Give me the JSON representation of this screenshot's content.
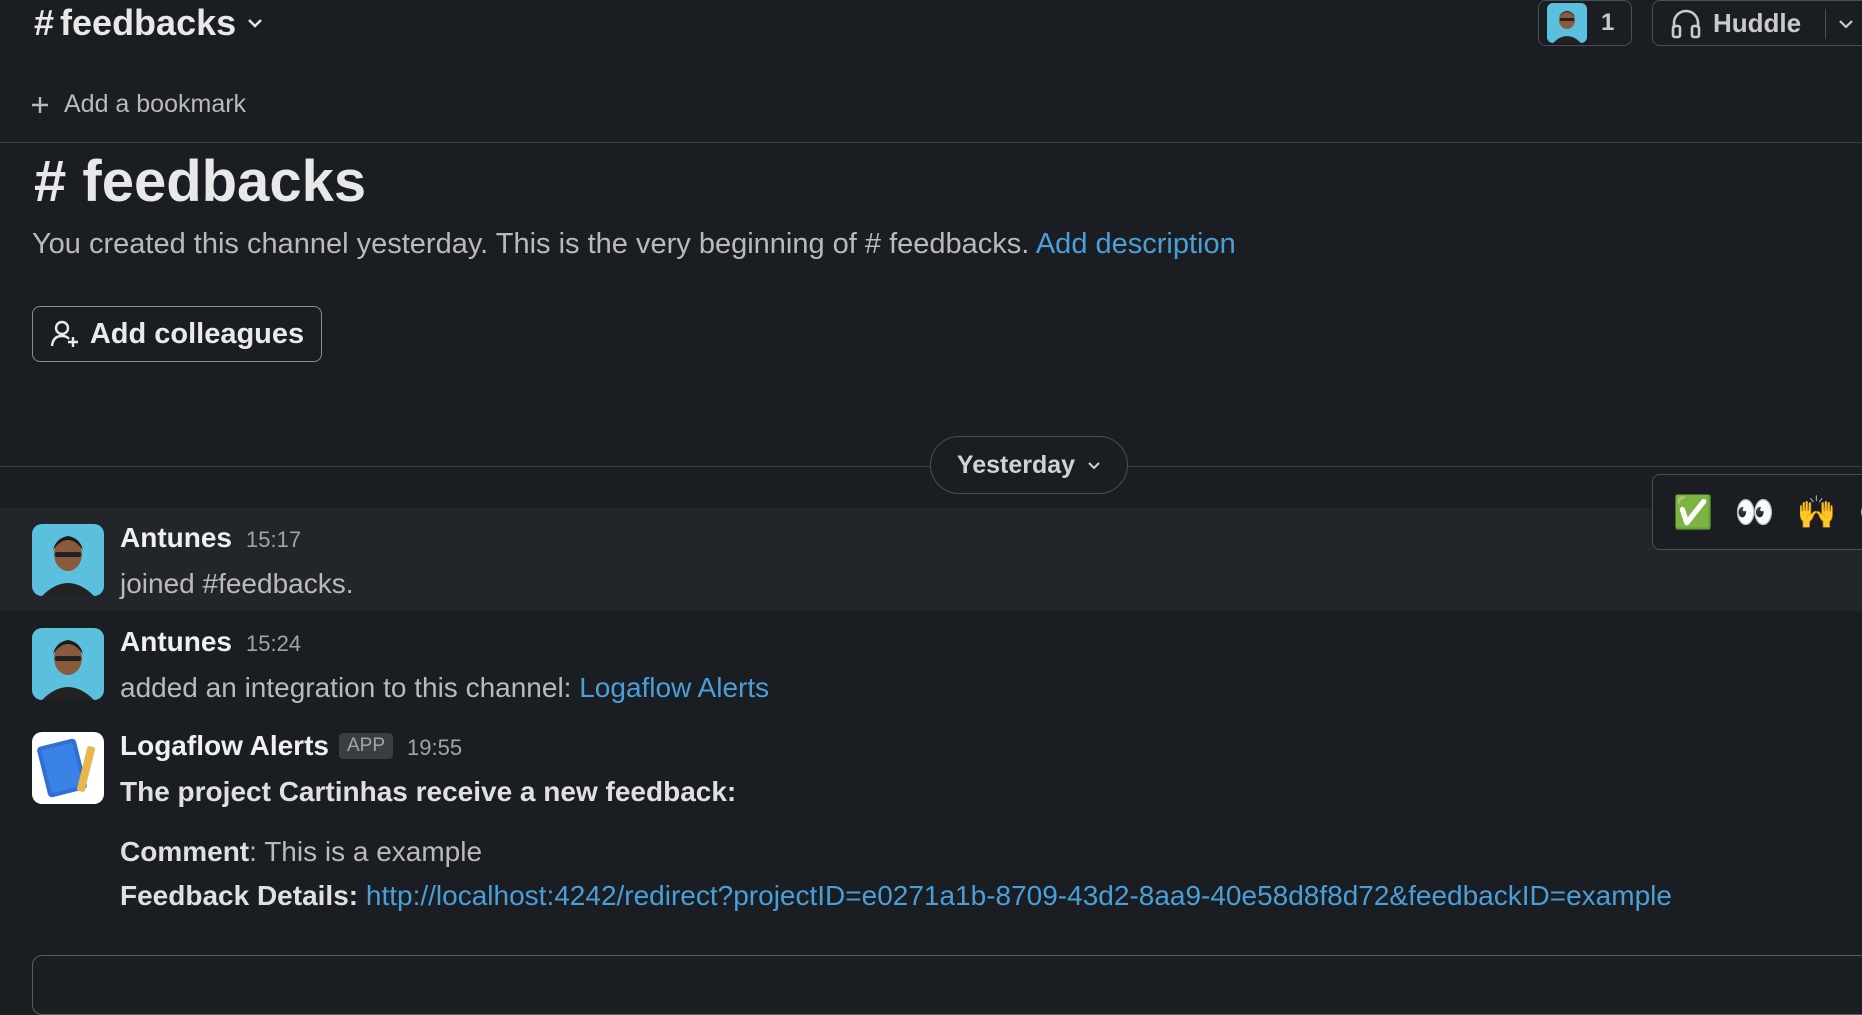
{
  "header": {
    "channel_name": "feedbacks",
    "member_count": "1",
    "huddle_label": "Huddle",
    "bookmark_label": "Add a bookmark"
  },
  "intro": {
    "title": "feedbacks",
    "text_prefix": "You created this channel yesterday. This is the very beginning of ",
    "channel_ref": "# feedbacks.",
    "add_description": "Add description",
    "add_colleagues": "Add colleagues"
  },
  "divider": {
    "label": "Yesterday"
  },
  "reactions": [
    "✅",
    "👀",
    "🙌"
  ],
  "messages": [
    {
      "author": "Antunes",
      "time": "15:17",
      "text": "joined #feedbacks."
    },
    {
      "author": "Antunes",
      "time": "15:24",
      "text": "added an integration to this channel: ",
      "link": "Logaflow Alerts"
    },
    {
      "author": "Logaflow Alerts",
      "badge": "APP",
      "time": "19:55",
      "headline": "The project Cartinhas receive a new feedback:",
      "comment_label": "Comment",
      "comment_value": "This is a example",
      "details_label": "Feedback Details:",
      "details_url": "http://localhost:4242/redirect?projectID=e0271a1b-8709-43d2-8aa9-40e58d8f8d72&feedbackID=example"
    }
  ],
  "colors": {
    "background": "#1a1d21",
    "link": "#4a9fd9"
  }
}
